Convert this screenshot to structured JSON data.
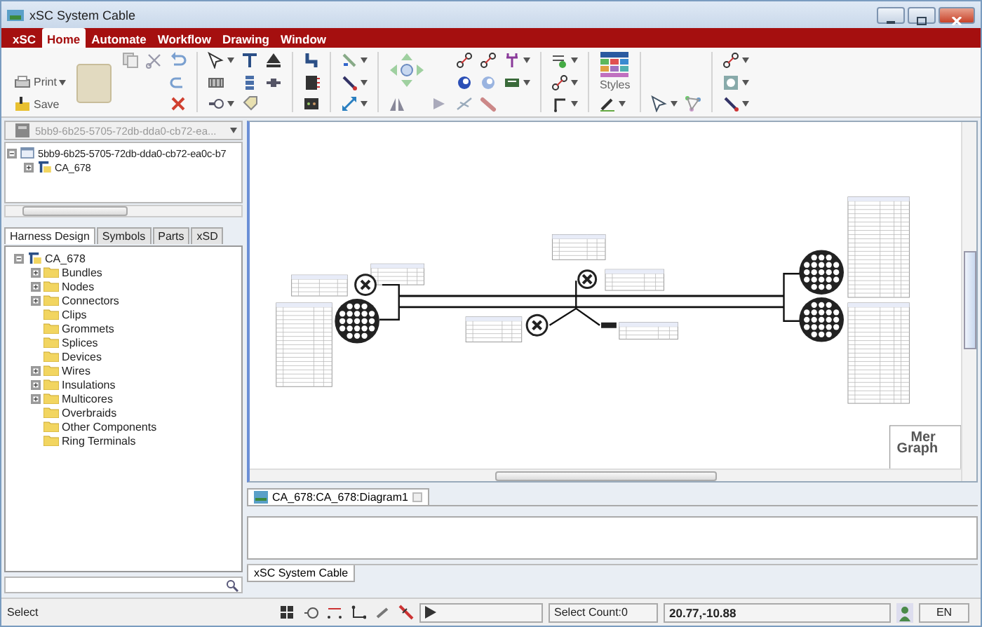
{
  "window": {
    "title": "xSC System Cable"
  },
  "menu": [
    {
      "label": "xSC",
      "selected": false
    },
    {
      "label": "Home",
      "selected": true
    },
    {
      "label": "Automate",
      "selected": false
    },
    {
      "label": "Workflow",
      "selected": false
    },
    {
      "label": "Drawing",
      "selected": false
    },
    {
      "label": "Window",
      "selected": false
    }
  ],
  "ribbon": {
    "print_label": "Print",
    "save_label": "Save",
    "styles_label": "Styles"
  },
  "project": {
    "selector": "5bb9-6b25-5705-72db-dda0-cb72-ea...",
    "tree": [
      {
        "label": "5bb9-6b25-5705-72db-dda0-cb72-ea0c-b7",
        "expanded": true,
        "children": [
          {
            "label": "CA_678",
            "expanded": false
          }
        ]
      }
    ]
  },
  "panel_tabs": [
    {
      "label": "Harness Design",
      "selected": true
    },
    {
      "label": "Symbols",
      "selected": false
    },
    {
      "label": "Parts",
      "selected": false
    },
    {
      "label": "xSD",
      "selected": false
    }
  ],
  "design_tree": [
    {
      "label": "CA_678",
      "expanded": true,
      "children": [
        {
          "label": "Bundles",
          "expanded": false
        },
        {
          "label": "Nodes",
          "expanded": false
        },
        {
          "label": "Connectors",
          "expanded": false
        },
        {
          "label": "Clips"
        },
        {
          "label": "Grommets"
        },
        {
          "label": "Splices"
        },
        {
          "label": "Devices"
        },
        {
          "label": "Wires",
          "expanded": false
        },
        {
          "label": "Insulations",
          "expanded": false
        },
        {
          "label": "Multicores",
          "expanded": false
        },
        {
          "label": "Overbraids"
        },
        {
          "label": "Other Components"
        },
        {
          "label": "Ring Terminals"
        }
      ]
    }
  ],
  "diagram": {
    "title_block": [
      "Mer",
      "Graph"
    ]
  },
  "editor_tab": "CA_678:CA_678:Diagram1",
  "output_tab": "xSC System Cable",
  "status_bar": {
    "mode": "Select",
    "select_count": "Select Count:0",
    "coordinates": "20.77,-10.88",
    "language": "EN"
  }
}
